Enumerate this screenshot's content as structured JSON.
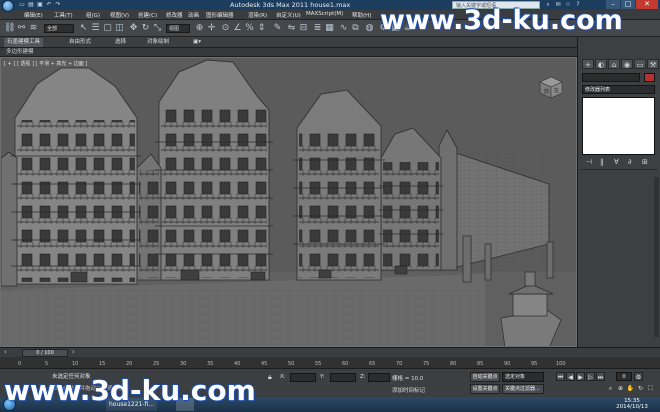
{
  "window": {
    "title": "Autodesk 3ds Max  2011      house1.max",
    "search_placeholder": "输入关键字或短语"
  },
  "menus": [
    "编辑(E)",
    "工具(T)",
    "组(G)",
    "视图(V)",
    "创建(C)",
    "修改器",
    "动画",
    "图形编辑器",
    "渲染(R)",
    "自定义(U)",
    "MAXScript(M)",
    "帮助(H)"
  ],
  "toolbar": {
    "selection_filter": "全部",
    "view_dropdown": "视图"
  },
  "ribbon": {
    "tabs": [
      "石墨建模工具",
      "自由形式",
      "选择",
      "对象绘制"
    ],
    "subpanel_label": "多边形建模"
  },
  "viewport": {
    "label": "[ + ] [ 透视 ] [ 平滑 + 高光 + 边面 ]",
    "viewcube_faces": [
      "前",
      "左"
    ]
  },
  "command_panel": {
    "tabs": [
      "+",
      "◐",
      "⌂",
      "◉",
      "▭",
      "⚒"
    ],
    "object_name": "",
    "modifier_list": "修改器列表",
    "stack_buttons": [
      "⊣",
      "‖",
      "∀",
      "∂",
      "⊞"
    ]
  },
  "timeline": {
    "frame_counter": "0 / 100",
    "ticks": [
      "0",
      "5",
      "10",
      "15",
      "20",
      "25",
      "30",
      "35",
      "40",
      "45",
      "50",
      "55",
      "60",
      "65",
      "70",
      "75",
      "80",
      "85",
      "90",
      "95",
      "100"
    ]
  },
  "status": {
    "prompt": "未选定任何对象",
    "hint": "单击或单击并拖动以选择对象",
    "x_label": "X:",
    "y_label": "Y:",
    "z_label": "Z:",
    "x_value": "",
    "y_value": "",
    "z_value": "",
    "grid": "栅格 = 10.0",
    "time_tag": "添加时间标记",
    "autokey": "自动关键点",
    "selected_dropdown": "选定对象",
    "setkey": "设置关键点",
    "keyfilter": "关键点过滤器...",
    "current_frame": "0"
  },
  "taskbar": {
    "apps": [
      "Autodesk 3ds Max",
      "house1221-fi...",
      ""
    ],
    "clock_time": "15:35",
    "clock_date": "2014/10/13"
  },
  "watermark": {
    "top": "www.3d-ku.com",
    "bottom": "www.3d-ku.com"
  },
  "colors": {
    "viewport_bg": "#5b5b5b",
    "object_color": "#b63232",
    "autokey_active": "#c0392b"
  }
}
